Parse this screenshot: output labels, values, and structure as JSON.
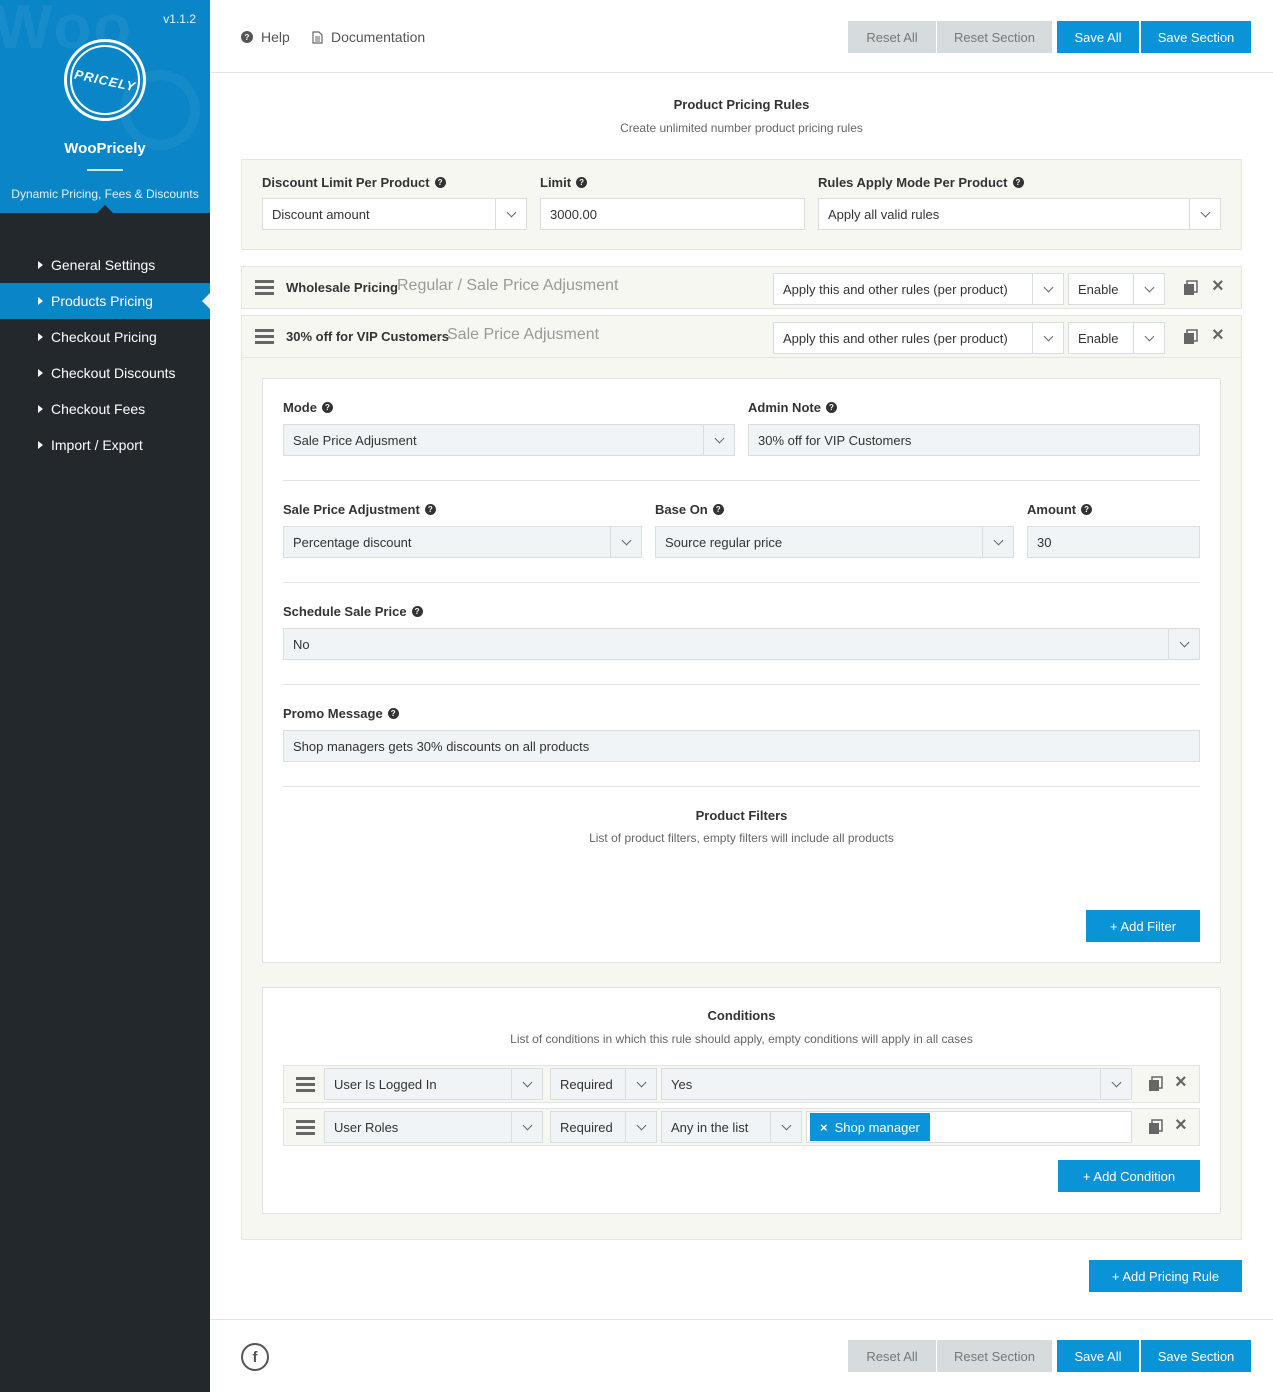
{
  "app": {
    "version": "v1.1.2",
    "logo_text": "PRICELY",
    "name": "WooPricely",
    "tagline": "Dynamic Pricing, Fees & Discounts"
  },
  "nav": {
    "items": [
      {
        "label": "General Settings",
        "active": false
      },
      {
        "label": "Products Pricing",
        "active": true
      },
      {
        "label": "Checkout Pricing",
        "active": false
      },
      {
        "label": "Checkout Discounts",
        "active": false
      },
      {
        "label": "Checkout Fees",
        "active": false
      },
      {
        "label": "Import / Export",
        "active": false
      }
    ]
  },
  "toolbar": {
    "help": "Help",
    "documentation": "Documentation",
    "reset_all": "Reset All",
    "reset_section": "Reset Section",
    "save_all": "Save All",
    "save_section": "Save Section"
  },
  "page": {
    "title": "Product Pricing Rules",
    "subtitle": "Create unlimited number product pricing rules"
  },
  "global": {
    "discount_limit_label": "Discount Limit Per Product",
    "discount_limit_value": "Discount amount",
    "limit_label": "Limit",
    "limit_value": "3000.00",
    "apply_mode_label": "Rules Apply Mode Per Product",
    "apply_mode_value": "Apply all valid rules"
  },
  "rules": [
    {
      "name": "Wholesale Pricing",
      "mode": "Regular / Sale Price Adjusment",
      "apply": "Apply this and other rules (per product)",
      "status": "Enable"
    },
    {
      "name": "30% off for VIP Customers",
      "mode": "Sale Price Adjusment",
      "apply": "Apply this and other rules (per product)",
      "status": "Enable"
    }
  ],
  "rule_form": {
    "mode_label": "Mode",
    "mode_value": "Sale Price Adjusment",
    "admin_note_label": "Admin Note",
    "admin_note_value": "30% off for VIP Customers",
    "spa_label": "Sale Price Adjustment",
    "spa_value": "Percentage discount",
    "base_on_label": "Base On",
    "base_on_value": "Source regular price",
    "amount_label": "Amount",
    "amount_value": "30",
    "schedule_label": "Schedule Sale Price",
    "schedule_value": "No",
    "promo_label": "Promo Message",
    "promo_value": "Shop managers gets 30% discounts on all products"
  },
  "filters": {
    "title": "Product Filters",
    "subtitle": "List of product filters, empty filters will include all products",
    "add_label": "+ Add Filter"
  },
  "conditions": {
    "title": "Conditions",
    "subtitle": "List of conditions in which this rule should apply, empty conditions will apply in all cases",
    "rows": [
      {
        "type": "User Is Logged In",
        "req": "Required",
        "value": "Yes"
      },
      {
        "type": "User Roles",
        "req": "Required",
        "op": "Any in the list",
        "tag": "Shop manager"
      }
    ],
    "add_label": "+ Add Condition"
  },
  "add_rule_label": "+ Add Pricing Rule",
  "footer_social": "f",
  "colors": {
    "accent": "#0a93d6",
    "sidebar": "#23282d",
    "brand": "#0a85c7"
  }
}
